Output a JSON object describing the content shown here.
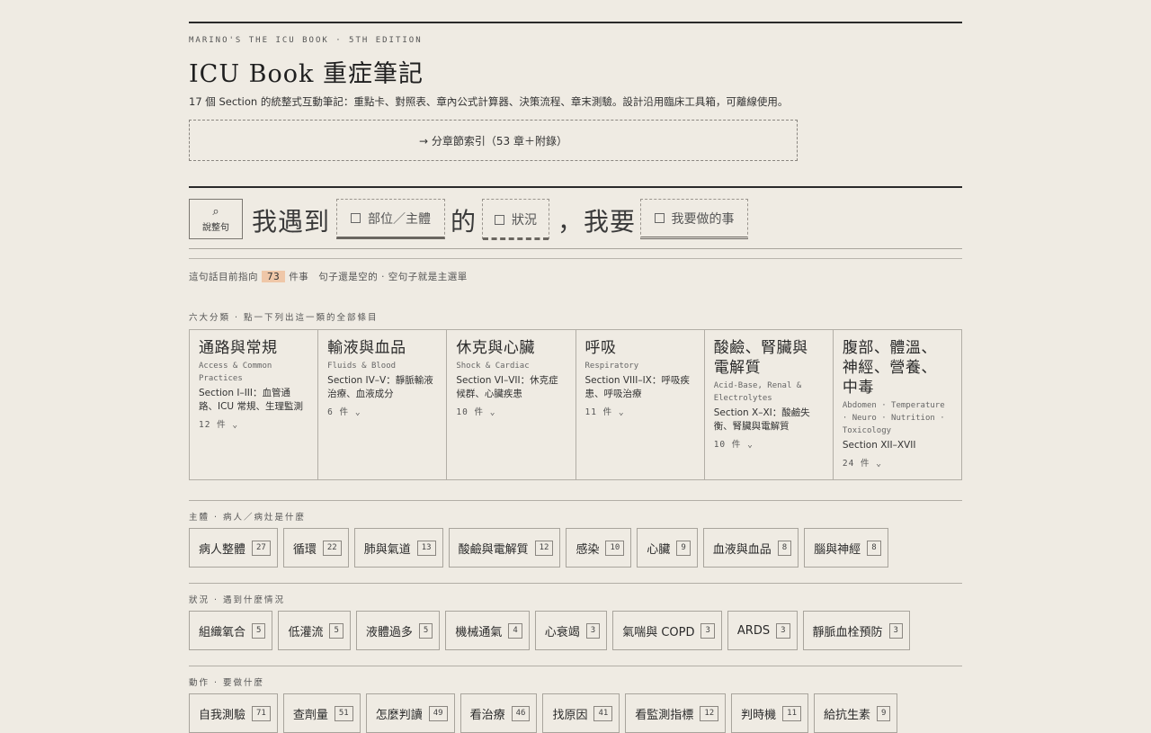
{
  "header": {
    "eyebrow": "MARINO'S THE ICU BOOK · 5TH EDITION",
    "title": "ICU Book 重症筆記",
    "subtitle": "17 個 Section 的統整式互動筆記：重點卡、對照表、章內公式計算器、決策流程、章末測驗。設計沿用臨床工具箱，可離線使用。",
    "index_button": "→ 分章節索引（53 章＋附錄）"
  },
  "sentence": {
    "say_button_icon": "⌕",
    "say_button_label": "說整句",
    "word1": "我遇到",
    "slot1": "部位／主體",
    "word2": "的",
    "slot2": "狀況",
    "word3": "，我要",
    "slot3": "我要做的事"
  },
  "pointer": {
    "prefix": "這句話目前指向",
    "count": "73",
    "suffix": "件事　句子還是空的 · 空句子就是主選單"
  },
  "categories_label": "六大分類 · 點一下列出這一類的全部條目",
  "categories": [
    {
      "zh": "通路與常規",
      "en": "Access & Common Practices",
      "desc": "Section I–III：血管通路、ICU 常規、生理監測",
      "count": "12 件 ⌄"
    },
    {
      "zh": "輸液與血品",
      "en": "Fluids & Blood",
      "desc": "Section IV–V：靜脈輸液治療、血液成分",
      "count": "6 件 ⌄"
    },
    {
      "zh": "休克與心臟",
      "en": "Shock & Cardiac",
      "desc": "Section VI–VII：休克症候群、心臟疾患",
      "count": "10 件 ⌄"
    },
    {
      "zh": "呼吸",
      "en": "Respiratory",
      "desc": "Section VIII–IX：呼吸疾患、呼吸治療",
      "count": "11 件 ⌄"
    },
    {
      "zh": "酸鹼、腎臟與電解質",
      "en": "Acid-Base, Renal & Electrolytes",
      "desc": "Section X–XI：酸鹼失衡、腎臟與電解質",
      "count": "10 件 ⌄"
    },
    {
      "zh": "腹部、體溫、神經、營養、中毒",
      "en": "Abdomen · Temperature · Neuro · Nutrition · Toxicology",
      "desc": "Section XII–XVII",
      "count": "24 件 ⌄"
    }
  ],
  "subject": {
    "label": "主體 · 病人／病灶是什麼",
    "chips": [
      {
        "label": "病人整體",
        "n": "27"
      },
      {
        "label": "循環",
        "n": "22"
      },
      {
        "label": "肺與氣道",
        "n": "13"
      },
      {
        "label": "酸鹼與電解質",
        "n": "12"
      },
      {
        "label": "感染",
        "n": "10"
      },
      {
        "label": "心臟",
        "n": "9"
      },
      {
        "label": "血液與血品",
        "n": "8"
      },
      {
        "label": "腦與神經",
        "n": "8"
      }
    ]
  },
  "situation": {
    "label": "狀況 · 遇到什麼情況",
    "chips": [
      {
        "label": "組織氧合",
        "n": "5"
      },
      {
        "label": "低灌流",
        "n": "5"
      },
      {
        "label": "液體過多",
        "n": "5"
      },
      {
        "label": "機械通氣",
        "n": "4"
      },
      {
        "label": "心衰竭",
        "n": "3"
      },
      {
        "label": "氣喘與 COPD",
        "n": "3"
      },
      {
        "label": "ARDS",
        "n": "3"
      },
      {
        "label": "靜脈血栓預防",
        "n": "3"
      }
    ]
  },
  "action": {
    "label": "動作 · 要做什麼",
    "chips": [
      {
        "label": "自我測驗",
        "n": "71"
      },
      {
        "label": "查劑量",
        "n": "51"
      },
      {
        "label": "怎麼判讀",
        "n": "49"
      },
      {
        "label": "看治療",
        "n": "46"
      },
      {
        "label": "找原因",
        "n": "41"
      },
      {
        "label": "看監測指標",
        "n": "12"
      },
      {
        "label": "判時機",
        "n": "11"
      },
      {
        "label": "給抗生素",
        "n": "9"
      }
    ]
  }
}
